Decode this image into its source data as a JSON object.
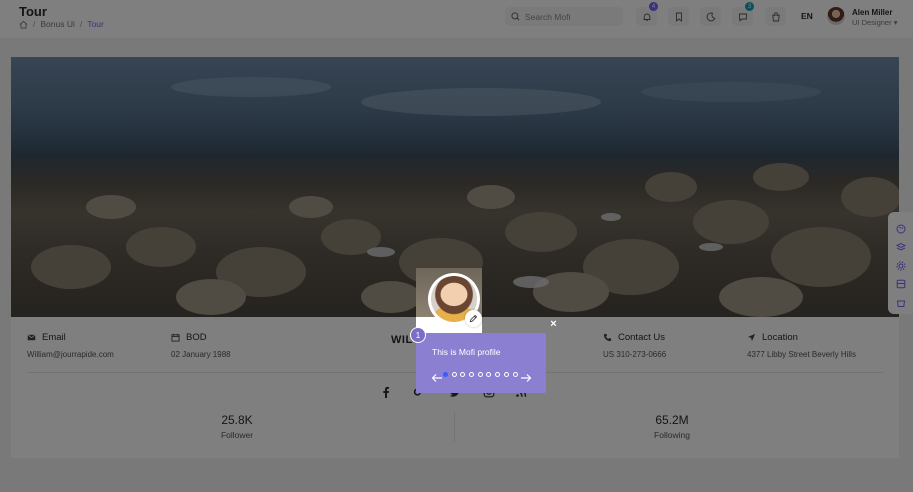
{
  "header": {
    "title": "Tour",
    "breadcrumb": [
      "Bonus Ui",
      "Tour"
    ],
    "search_placeholder": "Search Mofi",
    "notifications_count": "4",
    "messages_count": "3",
    "language": "EN",
    "user_name": "Alen Miller",
    "user_role": "UI Designer",
    "accent": "#7366ff"
  },
  "profile": {
    "email_label": "Email",
    "email_value": "William@jourrapide.com",
    "bod_label": "BOD",
    "bod_value": "02 January 1988",
    "name_partial": "WIL",
    "contact_label": "Contact Us",
    "contact_value": "US 310-273-0666",
    "location_label": "Location",
    "location_value": "4377 Libby Street Beverly Hills",
    "social_icons": [
      "facebook-icon",
      "google-plus-icon",
      "twitter-icon",
      "instagram-icon",
      "rss-icon"
    ],
    "stats": [
      {
        "value": "25.8K",
        "label": "Follower"
      },
      {
        "value": "65.2M",
        "label": "Following"
      }
    ]
  },
  "tour": {
    "step_number": "1",
    "text": "This is Mofi profile",
    "close": "×",
    "total_steps": 9,
    "current_step": 1,
    "tooltip_color": "#8a7fd1"
  }
}
